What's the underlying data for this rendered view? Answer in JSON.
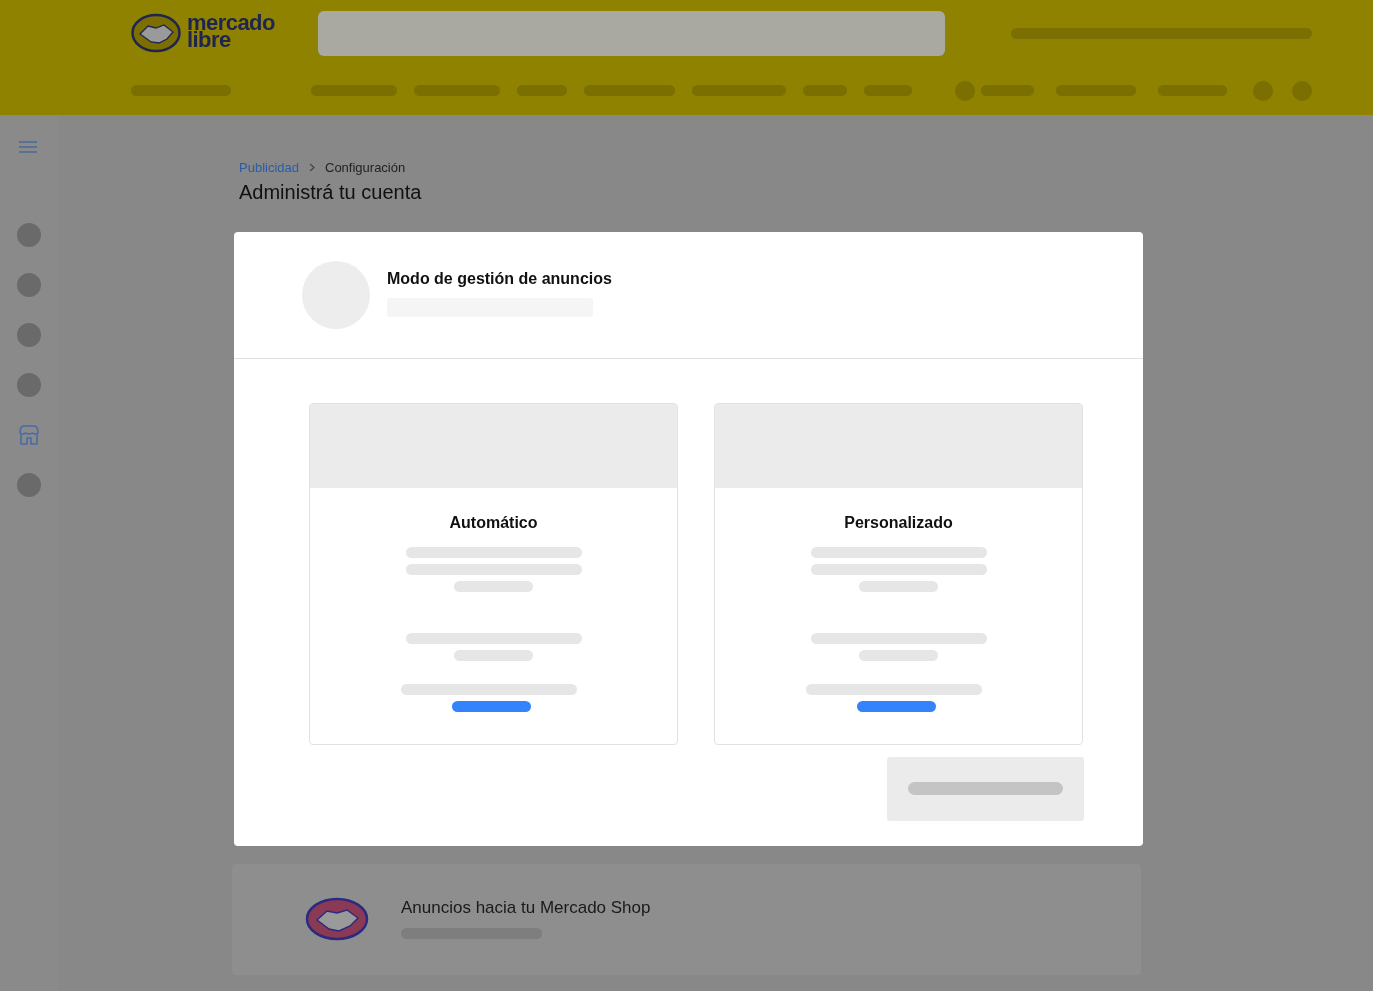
{
  "header": {
    "logo": [
      "mercado",
      "libre"
    ]
  },
  "breadcrumb": [
    {
      "label": "Publicidad",
      "kind": "link"
    },
    {
      "label": "Configuración",
      "kind": "current"
    }
  ],
  "page_title": "Administrá tu cuenta",
  "modal": {
    "title": "Modo de gestión de anuncios",
    "options": [
      {
        "title": "Automático"
      },
      {
        "title": "Personalizado"
      }
    ]
  },
  "shop_card": {
    "title": "Anuncios hacia tu Mercado Shop"
  }
}
